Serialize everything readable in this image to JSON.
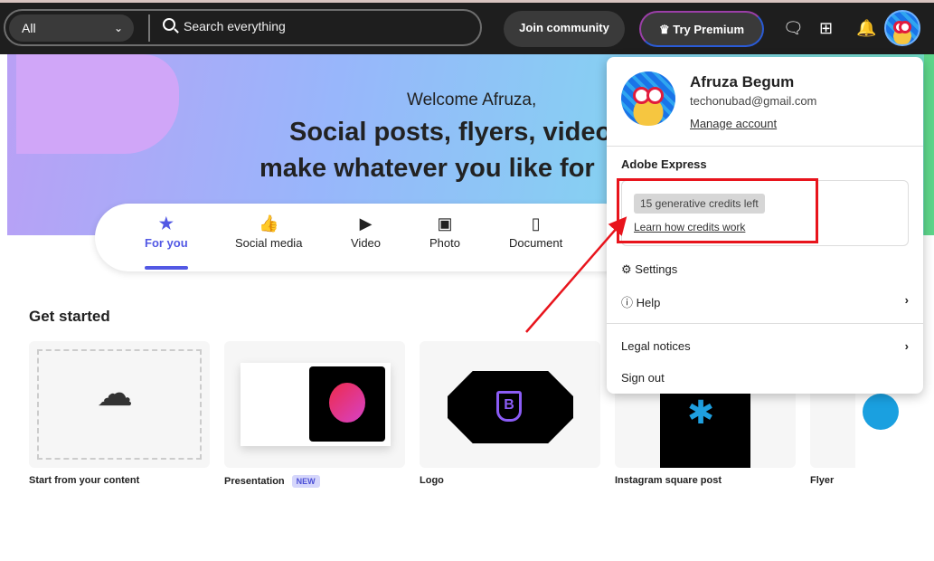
{
  "topbar": {
    "filter": "All",
    "search_placeholder": "Search everything",
    "join": "Join community",
    "premium": "Try Premium"
  },
  "hero": {
    "welcome": "Welcome Afruza,",
    "headline_1": "Social posts, flyers, videos,",
    "headline_2": "make whatever you like for"
  },
  "tabs": [
    {
      "label": "For you",
      "icon": "star"
    },
    {
      "label": "Social media",
      "icon": "thumbs-up"
    },
    {
      "label": "Video",
      "icon": "play"
    },
    {
      "label": "Photo",
      "icon": "image"
    },
    {
      "label": "Document",
      "icon": "document"
    }
  ],
  "section": {
    "title": "Get started"
  },
  "cards": [
    {
      "label": "Start from your content"
    },
    {
      "label": "Presentation",
      "badge": "NEW"
    },
    {
      "label": "Logo"
    },
    {
      "label": "Instagram square post"
    },
    {
      "label": "Flyer"
    }
  ],
  "account": {
    "name": "Afruza Begum",
    "email": "techonubad@gmail.com",
    "manage": "Manage account",
    "app": "Adobe Express",
    "credits": "15 generative credits left",
    "credits_link": "Learn how credits work",
    "settings": "Settings",
    "help": "Help",
    "legal": "Legal notices",
    "signout": "Sign out"
  },
  "colors": {
    "accent": "#5258e4",
    "annotation": "#e8141c"
  }
}
